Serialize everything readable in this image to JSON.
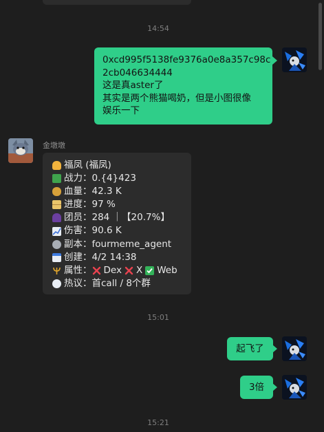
{
  "messages": {
    "time1": "14:54",
    "msg1": {
      "line1": "0xcd995f5138fe9376a0e8a357c98c",
      "line2": "2cb046634444",
      "line3": "这是真aster了",
      "line4": "其实是两个熊猫喝奶，但是小图很像",
      "line5": "娱乐一下"
    },
    "sender2": "金墩墩",
    "bot": {
      "title": "福凤 (福凤)",
      "power_label": "战力：",
      "power_value": "0.{4}423",
      "hp_label": "血量：",
      "hp_value": "42.3 K",
      "progress_label": "进度：",
      "progress_value": "97 %",
      "members_label": "团员：",
      "members_value": "284 ｜【20.7%】",
      "damage_label": "伤害：",
      "damage_value": "90.6 K",
      "dungeon_label": "副本：",
      "dungeon_value": "fourmeme_agent",
      "created_label": "创建：",
      "created_value": "4/2 14:38",
      "attr_label": "属性：",
      "attr_dex": "Dex",
      "attr_x": "X",
      "attr_web": "Web",
      "hot_label": "热议：",
      "hot_value": "首call / 8个群"
    },
    "time2": "15:01",
    "msg3": "起飞了",
    "msg4": "3倍",
    "time3": "15:21"
  },
  "colors": {
    "background": "#1e1e1e",
    "bubble_green": "#2fce89",
    "bubble_dark": "#2c2c2c"
  },
  "icons": {
    "title": "raised-hand-icon",
    "power": "money-icon",
    "hp": "money-bag-icon",
    "progress": "hourglass-icon",
    "members": "person-icon",
    "damage": "chart-up-icon",
    "dungeon": "gear-icon",
    "created": "calendar-icon",
    "attr": "trident-icon",
    "hot": "speech-bubble-icon"
  }
}
